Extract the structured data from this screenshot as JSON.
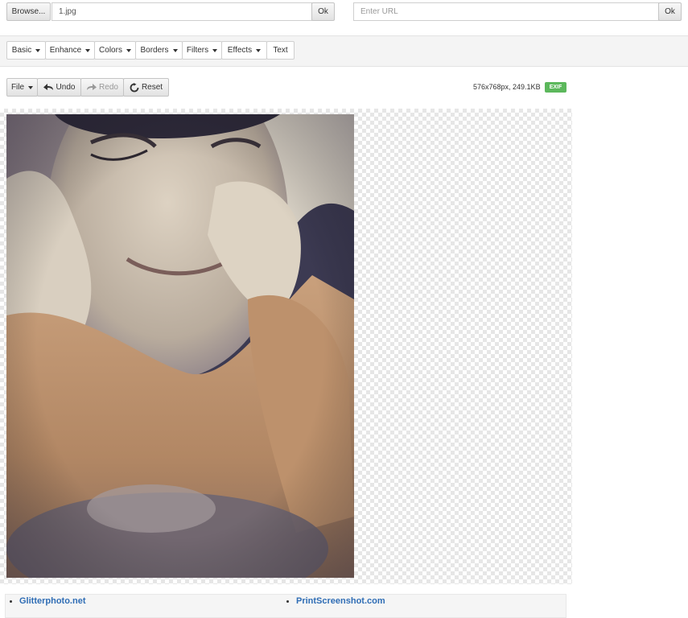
{
  "top": {
    "browse_label": "Browse...",
    "file_value": "1.jpg",
    "ok_label": "Ok",
    "url_placeholder": "Enter URL",
    "url_ok_label": "Ok"
  },
  "menu": [
    {
      "label": "Basic"
    },
    {
      "label": "Enhance"
    },
    {
      "label": "Colors"
    },
    {
      "label": "Borders"
    },
    {
      "label": "Filters"
    },
    {
      "label": "Effects"
    },
    {
      "label": "Text"
    }
  ],
  "actions": {
    "file_label": "File",
    "undo_label": "Undo",
    "redo_label": "Redo",
    "reset_label": "Reset"
  },
  "image_info": {
    "dimensions": "576x768px, 249.1KB",
    "exif_badge": "EXIF",
    "badge_color": "#5cb85c"
  },
  "footer_links": [
    {
      "title": "Glitterphoto.net"
    },
    {
      "title": "PrintScreenshot.com"
    }
  ]
}
